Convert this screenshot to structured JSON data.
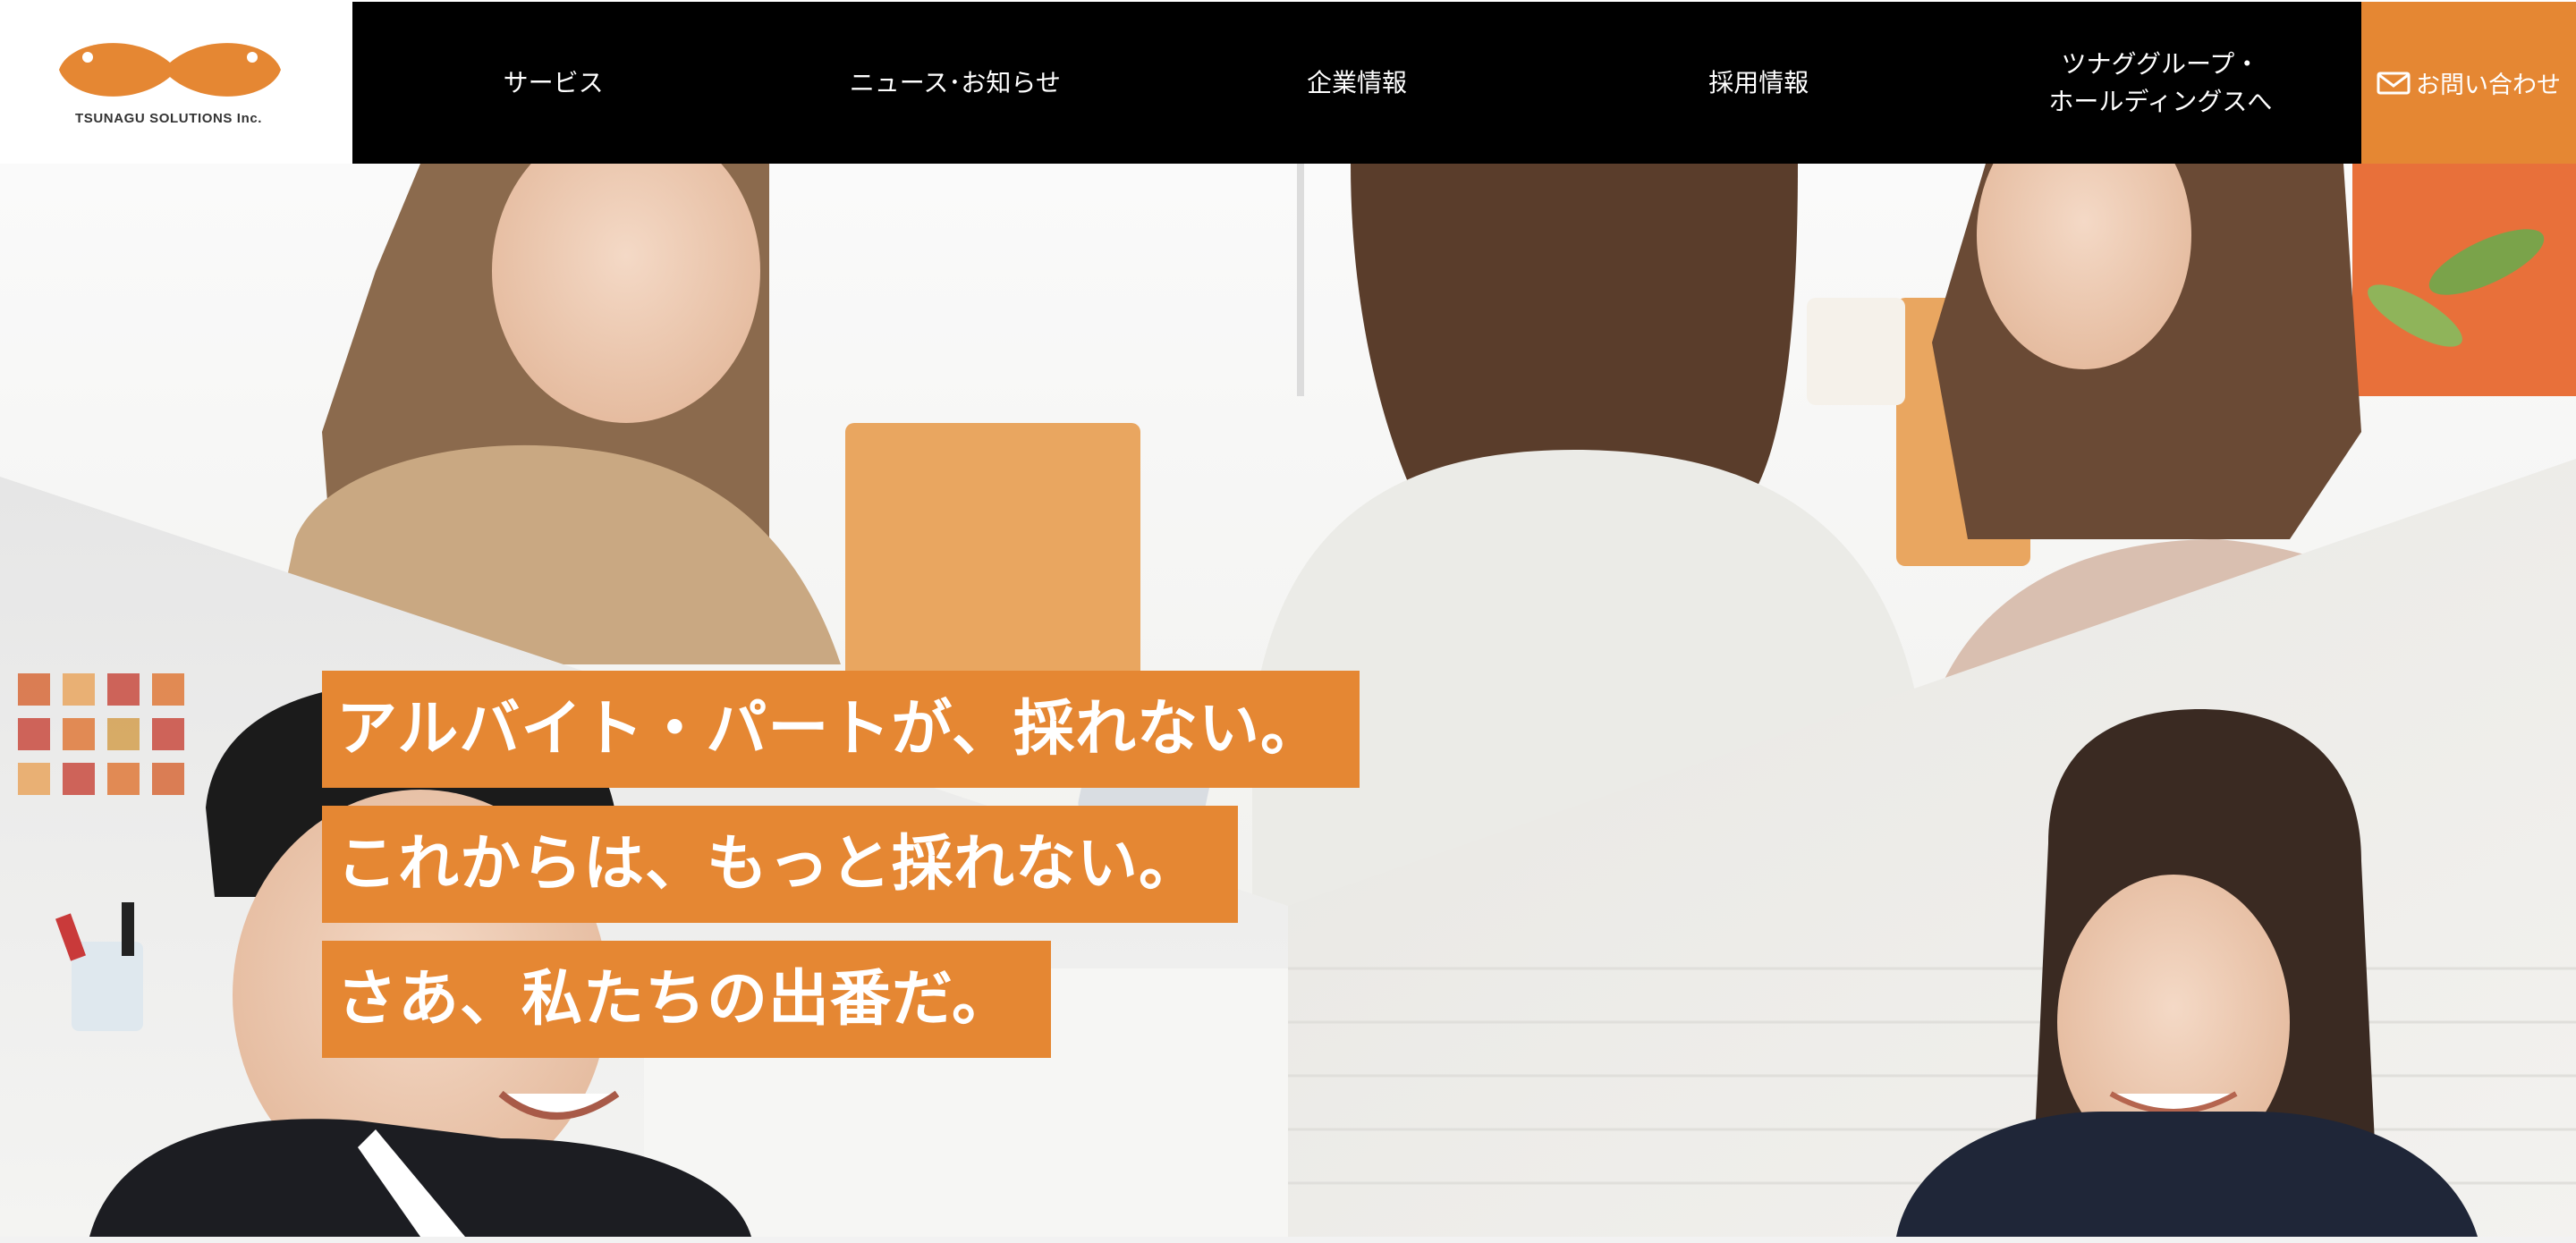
{
  "brand": {
    "logo_text": "TSUNAGU SOLUTIONS Inc.",
    "accent_color": "#e58733",
    "nav_bg_color": "#000000"
  },
  "nav": {
    "items": [
      {
        "label": "サービス"
      },
      {
        "label": "ニュース･お知らせ"
      },
      {
        "label": "企業情報"
      },
      {
        "label": "採用情報"
      },
      {
        "label_line1": "ツナググループ・",
        "label_line2": "ホールディングスへ"
      }
    ]
  },
  "contact": {
    "icon": "mail-icon",
    "label": "お問い合わせ"
  },
  "hero": {
    "headline": [
      "アルバイト・パートが、採れない。",
      "これからは、もっと採れない。",
      "さあ、私たちの出番だ。"
    ]
  }
}
